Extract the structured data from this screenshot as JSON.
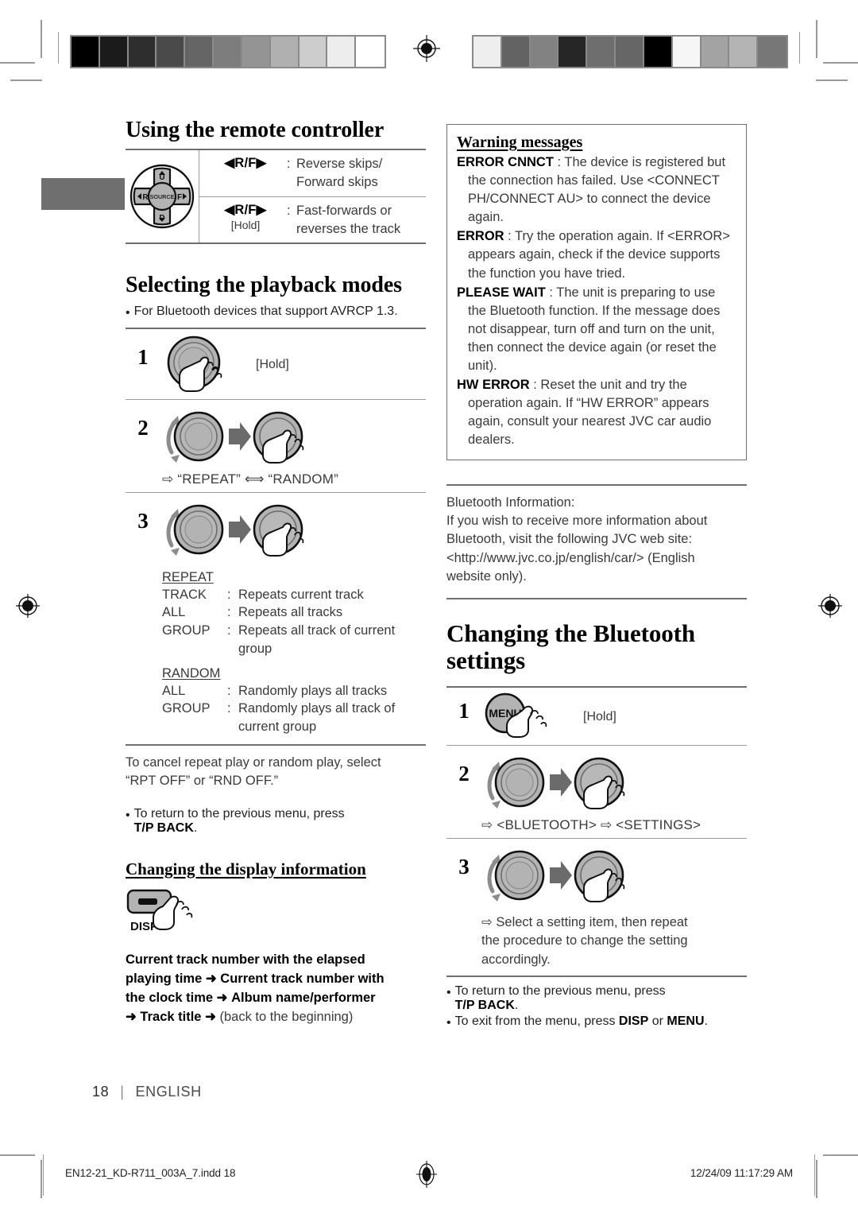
{
  "page": {
    "number": "18",
    "separator": "|",
    "language": "ENGLISH"
  },
  "imprint": {
    "file": "EN12-21_KD-R711_003A_7.indd   18",
    "datetime": "12/24/09   11:17:29 AM"
  },
  "calibration": {
    "left_bar": [
      "#000000",
      "#1b1b1b",
      "#2e2e2e",
      "#4a4a4a",
      "#656565",
      "#7d7d7d",
      "#949494",
      "#b0b0b0",
      "#cdcdcd",
      "#ededed",
      "#ffffff"
    ],
    "right_bar": [
      "#eeeeee",
      "#636363",
      "#828282",
      "#262626",
      "#6e6e6e",
      "#666666",
      "#000000",
      "#f6f6f6",
      "#a3a3a3",
      "#b4b4b4",
      "#777777"
    ]
  },
  "left_column": {
    "remote_heading": "Using the remote controller",
    "remote_pad": {
      "up": "U",
      "down": "D",
      "left": "R",
      "right": "F",
      "center": "SOURCE"
    },
    "remote_rows": [
      {
        "key": "R/F",
        "key_prefix": "◀",
        "key_suffix": "▶",
        "hold": "",
        "desc_lines": [
          "Reverse skips/",
          "Forward skips"
        ]
      },
      {
        "key": "R/F",
        "key_prefix": "◀",
        "key_suffix": "▶",
        "hold": "[Hold]",
        "desc_lines": [
          "Fast-forwards or",
          "reverses the track"
        ]
      }
    ],
    "playback_heading": "Selecting the playback modes",
    "playback_note": "For Bluetooth devices that support AVRCP 1.3.",
    "steps": [
      {
        "num": "1",
        "art": "dial-hold",
        "hold_label": "[Hold]",
        "result": ""
      },
      {
        "num": "2",
        "art": "dial-turn-press",
        "hold_label": "",
        "result": "⇨ “REPEAT” ⟺ “RANDOM”"
      },
      {
        "num": "3",
        "art": "dial-turn-press",
        "hold_label": "",
        "result": ""
      }
    ],
    "definitions": [
      {
        "head": "REPEAT",
        "rows": [
          {
            "term": "TRACK",
            "desc": "Repeats current track",
            "cont": ""
          },
          {
            "term": "ALL",
            "desc": "Repeats all tracks",
            "cont": ""
          },
          {
            "term": "GROUP",
            "desc": "Repeats all track of current",
            "cont": "group"
          }
        ]
      },
      {
        "head": "RANDOM",
        "rows": [
          {
            "term": "ALL",
            "desc": "Randomly plays all tracks",
            "cont": ""
          },
          {
            "term": "GROUP",
            "desc": "Randomly plays all track of",
            "cont": "current group"
          }
        ]
      }
    ],
    "cancel_text_lines": [
      "To cancel repeat play or random play, select",
      "“RPT OFF” or “RND OFF.”"
    ],
    "return_bullet": {
      "dot": "•",
      "text": "To return to the previous menu, press",
      "button": "T/P BACK",
      "period": "."
    },
    "display_heading": "Changing the display information",
    "disp_button_label": "DISP",
    "display_sequence": {
      "bold_parts": [
        "Current track number with the elapsed",
        "playing time",
        "Current track number with",
        "the clock time",
        "Album name/performer",
        "Track title"
      ],
      "tail": "(back to the beginning)",
      "arrow": "➜"
    }
  },
  "right_column": {
    "warning": {
      "heading": "Warning messages",
      "items": [
        {
          "label": "ERROR CNNCT",
          "lines": [
            " : The device is registered but",
            "the connection has failed. Use <CONNECT",
            "PH/CONNECT AU> to connect the device",
            "again."
          ]
        },
        {
          "label": "ERROR",
          "lines": [
            " : Try the operation again. If <ERROR>",
            "appears again, check if the device supports",
            "the function you have tried."
          ]
        },
        {
          "label": "PLEASE WAIT",
          "lines": [
            " : The unit is preparing to use",
            "the Bluetooth function. If the message does",
            "not disappear, turn off and turn on the unit,",
            "then connect the device again (or reset the",
            "unit)."
          ]
        },
        {
          "label": "HW ERROR",
          "lines": [
            " : Reset the unit and try the",
            "operation again. If “HW ERROR” appears",
            "again, consult your nearest JVC car audio",
            "dealers."
          ]
        }
      ]
    },
    "bt_info_lines": [
      "Bluetooth Information:",
      "If you wish to receive more information about",
      "Bluetooth, visit the following JVC web site:",
      "<http://www.jvc.co.jp/english/car/> (English",
      "website only)."
    ],
    "settings_heading": "Changing the Bluetooth settings",
    "steps": [
      {
        "num": "1",
        "art": "menu-hold",
        "button_label": "MENU",
        "hold_label": "[Hold]",
        "result": ""
      },
      {
        "num": "2",
        "art": "dial-turn-press",
        "button_label": "",
        "hold_label": "",
        "result": "⇨ <BLUETOOTH> ⇨ <SETTINGS>"
      },
      {
        "num": "3",
        "art": "dial-turn-press",
        "button_label": "",
        "hold_label": "",
        "result": ""
      }
    ],
    "select_note_lines": [
      "⇨ Select a setting item, then repeat",
      "the procedure to change the setting",
      "accordingly."
    ],
    "return_bullet": {
      "dot": "•",
      "text": "To return to the previous menu, press",
      "button": "T/P BACK",
      "period": "."
    },
    "exit_bullet": {
      "dot": "•",
      "prefix": "To exit from the menu, press ",
      "button1": "DISP",
      "mid": " or ",
      "button2": "MENU",
      "period": "."
    }
  }
}
